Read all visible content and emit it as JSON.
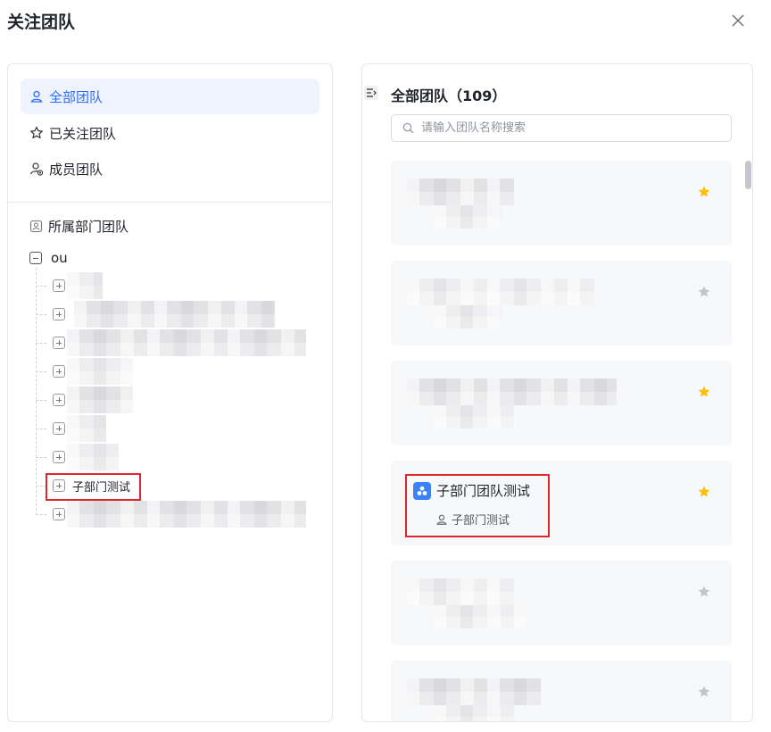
{
  "dialog": {
    "title": "关注团队"
  },
  "sidebar": {
    "nav_items": [
      {
        "label": "全部团队",
        "icon": "user-outline-icon",
        "active": true
      },
      {
        "label": "已关注团队",
        "icon": "star-outline-icon",
        "active": false
      },
      {
        "label": "成员团队",
        "icon": "member-icon",
        "active": false
      }
    ],
    "dept_section_label": "所属部门团队",
    "tree_root_label": "ou",
    "tree_visible_child_label": "子部门测试"
  },
  "main": {
    "title": "全部团队（109）",
    "search_placeholder": "请输入团队名称搜索",
    "visible_team": {
      "name": "子部门团队测试",
      "department": "子部门测试",
      "starred": true
    },
    "card_star_states": [
      true,
      false,
      true,
      true,
      false,
      false
    ]
  },
  "colors": {
    "accent": "#2f6bff",
    "star_active": "#fbbf0c",
    "star_inactive": "#c2c4c8",
    "highlight": "#e0262c"
  }
}
